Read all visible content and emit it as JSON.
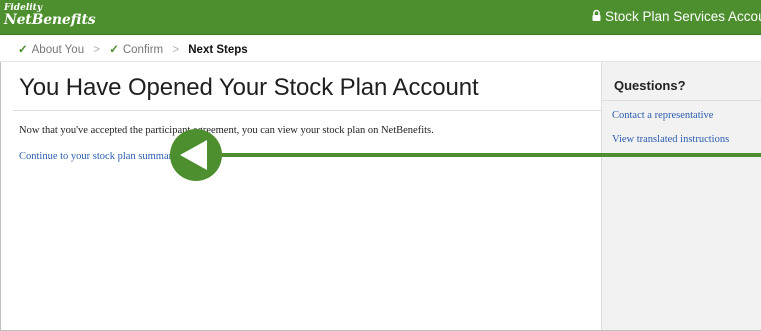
{
  "header": {
    "brand_line1": "Fidelity",
    "brand_line2": "NetBenefits",
    "account_label": "Stock Plan Services Account",
    "bar_color": "#4d8f2e"
  },
  "steps": [
    {
      "label": "About You",
      "state": "done"
    },
    {
      "label": "Confirm",
      "state": "done"
    },
    {
      "label": "Next Steps",
      "state": "current"
    }
  ],
  "main": {
    "title": "You Have Opened Your Stock Plan Account",
    "message": "Now that you've accepted the participant agreement, you can view your stock plan on NetBenefits.",
    "continue_link": "Continue to your stock plan summary."
  },
  "sidebar": {
    "title": "Questions?",
    "links": [
      "Contact a representative",
      "View translated instructions"
    ]
  },
  "overlay": {
    "indicator_color": "#4d8f2e",
    "icon": "left-arrow-pointer-icon"
  }
}
